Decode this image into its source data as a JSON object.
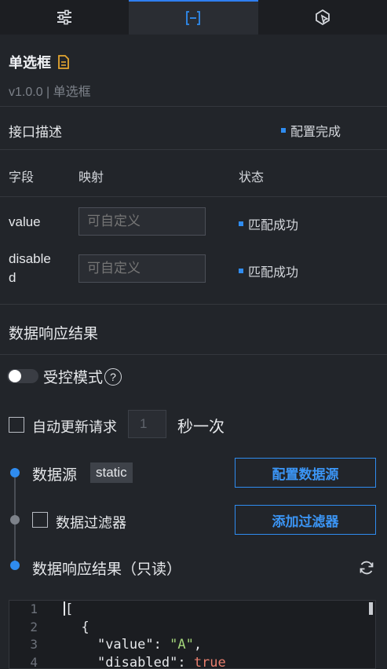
{
  "tabs": [
    {
      "name": "style-settings",
      "icon": "sliders-icon",
      "active": false
    },
    {
      "name": "data",
      "icon": "bracket-data-icon",
      "active": true
    },
    {
      "name": "interaction",
      "icon": "interaction-icon",
      "active": false
    }
  ],
  "component": {
    "title": "单选框",
    "version": "v1.0.0 | 单选框",
    "doc_icon": "document-icon"
  },
  "api": {
    "title": "接口描述",
    "status": "配置完成"
  },
  "mapping": {
    "headers": {
      "field": "字段",
      "mapping": "映射",
      "status": "状态"
    },
    "rows": [
      {
        "field": "value",
        "placeholder": "可自定义",
        "status": "匹配成功"
      },
      {
        "field": "disable\nd",
        "placeholder": "可自定义",
        "status": "匹配成功"
      }
    ]
  },
  "response": {
    "title": "数据响应结果",
    "controlled_label": "受控模式",
    "controlled_on": false,
    "auto_update_label": "自动更新请求",
    "interval_value": "1",
    "interval_suffix": "秒一次"
  },
  "datasource": {
    "source_label": "数据源",
    "source_type": "static",
    "config_button": "配置数据源",
    "filter_label": "数据过滤器",
    "add_filter_button": "添加过滤器",
    "result_label": "数据响应结果（只读）"
  },
  "editor": {
    "line_numbers": [
      "1",
      "2",
      "3",
      "4"
    ],
    "lines": [
      "[",
      "  {",
      "    \"value\": \"A\",",
      "    \"disabled\": true"
    ]
  },
  "colors": {
    "accent": "#2f8cf0",
    "background": "#22252a",
    "string": "#a3d47a",
    "boolean": "#e77e6d"
  }
}
